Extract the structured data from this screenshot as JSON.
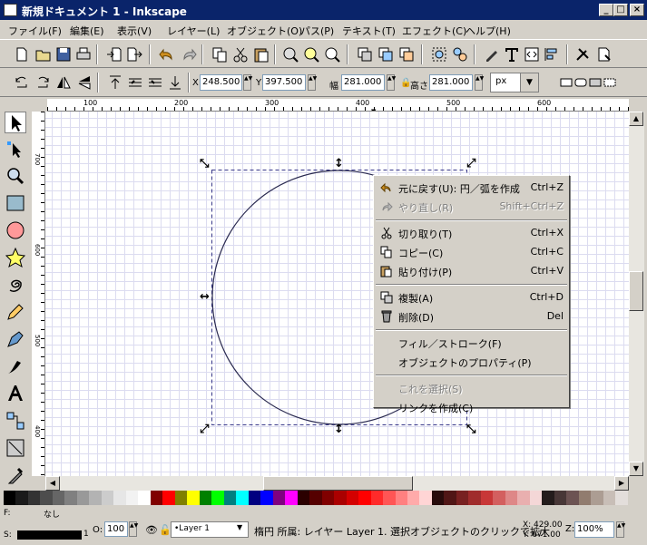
{
  "window": {
    "title": "新規ドキュメント 1 - Inkscape",
    "min": "_",
    "max": "□",
    "close": "×"
  },
  "menu": [
    "ファイル(F)",
    "編集(E)",
    "表示(V)",
    "レイヤー(L)",
    "オブジェクト(O)",
    "パス(P)",
    "テキスト(T)",
    "エフェクト(C)",
    "ヘルプ(H)"
  ],
  "controls": {
    "x_label": "X",
    "x_value": "248.500",
    "y_label": "Y",
    "y_value": "397.500",
    "w_label": "幅",
    "w_value": "281.000",
    "h_label": "高さ",
    "h_value": "281.000",
    "unit": "px"
  },
  "ruler": {
    "h_ticks": [
      "100",
      "200",
      "300",
      "400",
      "500",
      "600"
    ],
    "v_ticks": [
      "700",
      "600",
      "500",
      "400",
      "300"
    ]
  },
  "context_menu": [
    {
      "label": "元に戻す(U): 円／弧を作成",
      "shortcut": "Ctrl+Z",
      "icon": "undo-icon",
      "enabled": true
    },
    {
      "label": "やり直し(R)",
      "shortcut": "Shift+Ctrl+Z",
      "icon": "redo-icon",
      "enabled": false
    },
    {
      "label": "切り取り(T)",
      "shortcut": "Ctrl+X",
      "icon": "cut-icon",
      "enabled": true
    },
    {
      "label": "コピー(C)",
      "shortcut": "Ctrl+C",
      "icon": "copy-icon",
      "enabled": true
    },
    {
      "label": "貼り付け(P)",
      "shortcut": "Ctrl+V",
      "icon": "paste-icon",
      "enabled": true
    },
    {
      "label": "複製(A)",
      "shortcut": "Ctrl+D",
      "icon": "duplicate-icon",
      "enabled": true
    },
    {
      "label": "削除(D)",
      "shortcut": "Del",
      "icon": "delete-icon",
      "enabled": true
    },
    {
      "label": "フィル／ストローク(F)",
      "shortcut": "",
      "icon": "",
      "enabled": true
    },
    {
      "label": "オブジェクトのプロパティ(P)",
      "shortcut": "",
      "icon": "",
      "enabled": true
    },
    {
      "label": "これを選択(S)",
      "shortcut": "",
      "icon": "",
      "enabled": false
    },
    {
      "label": "リンクを作成(C)",
      "shortcut": "",
      "icon": "",
      "enabled": true
    }
  ],
  "palette": [
    "#000000",
    "#1a1a1a",
    "#333333",
    "#4d4d4d",
    "#666666",
    "#808080",
    "#999999",
    "#b3b3b3",
    "#cccccc",
    "#e6e6e6",
    "#f2f2f2",
    "#ffffff",
    "#800000",
    "#ff0000",
    "#808000",
    "#ffff00",
    "#008000",
    "#00ff00",
    "#008080",
    "#00ffff",
    "#000080",
    "#0000ff",
    "#800080",
    "#ff00ff",
    "#2b0000",
    "#550000",
    "#800000",
    "#aa0000",
    "#d40000",
    "#ff0000",
    "#ff2a2a",
    "#ff5555",
    "#ff8080",
    "#ffaaaa",
    "#ffd5d5",
    "#280b0b",
    "#501616",
    "#782121",
    "#a02c2c",
    "#c83737",
    "#d35f5f",
    "#de8787",
    "#e9afaf",
    "#f4d7d7",
    "#241c1c",
    "#483737",
    "#6c5353",
    "#917c6f",
    "#ac9d93",
    "#c8beb7",
    "#e3dedb"
  ],
  "status": {
    "fill_label": "F:",
    "fill_value": "なし",
    "stroke_label": "S:",
    "stroke_width": "1",
    "opacity_label": "O:",
    "opacity_value": "100",
    "layer": "•Layer 1",
    "message": "楕円 所属: レイヤー Layer 1. 選択オブジェクトのクリックで拡大",
    "cursor_x": "X: 429.00",
    "cursor_y": "Y: 671.00",
    "zoom_label": "Z:",
    "zoom_value": "100%"
  }
}
